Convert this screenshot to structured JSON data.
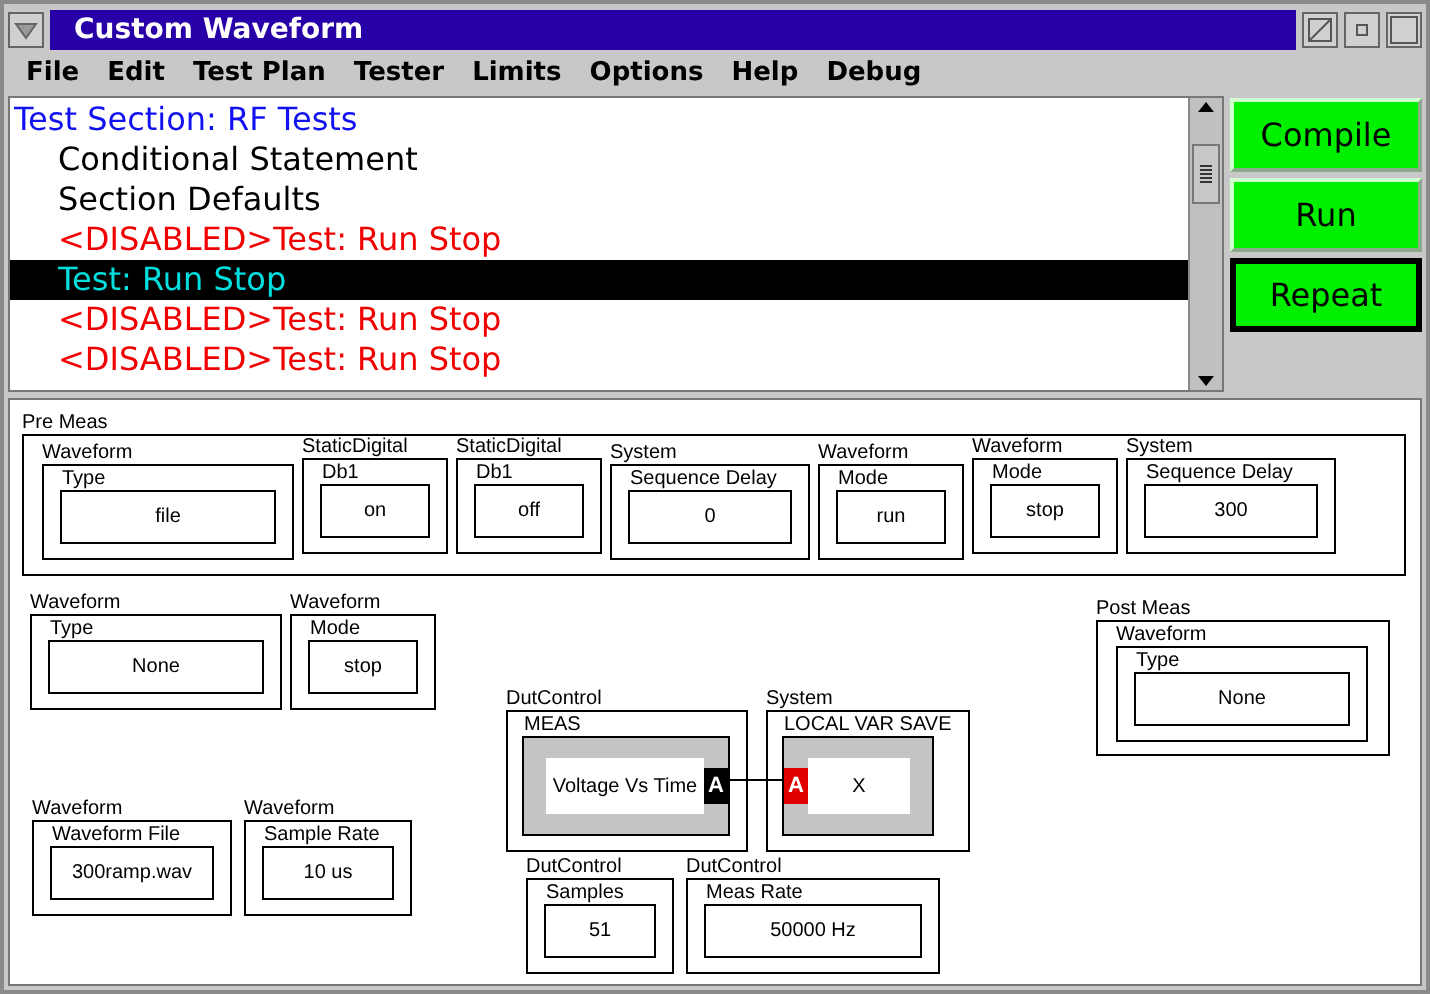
{
  "window": {
    "title": "Custom Waveform"
  },
  "menu": [
    "File",
    "Edit",
    "Test Plan",
    "Tester",
    "Limits",
    "Options",
    "Help",
    "Debug"
  ],
  "test_list": [
    {
      "label": "Test Section: RF Tests",
      "kind": "section",
      "disabled": false,
      "selected": false
    },
    {
      "label": "Conditional Statement",
      "kind": "item",
      "disabled": false,
      "selected": false
    },
    {
      "label": "Section Defaults",
      "kind": "item",
      "disabled": false,
      "selected": false
    },
    {
      "label": "<DISABLED>Test: Run Stop",
      "kind": "item",
      "disabled": true,
      "selected": false
    },
    {
      "label": "Test: Run Stop",
      "kind": "item",
      "disabled": false,
      "selected": true
    },
    {
      "label": "<DISABLED>Test: Run Stop",
      "kind": "item",
      "disabled": true,
      "selected": false
    },
    {
      "label": "<DISABLED>Test: Run Stop",
      "kind": "item",
      "disabled": true,
      "selected": false
    }
  ],
  "actions": [
    {
      "label": "Compile",
      "focused": false
    },
    {
      "label": "Run",
      "focused": false
    },
    {
      "label": "Repeat",
      "focused": true
    }
  ],
  "pre_meas": {
    "title": "Pre Meas",
    "blocks": [
      {
        "category": "Waveform",
        "label": "Type",
        "value": "file"
      },
      {
        "category": "StaticDigital",
        "label": "Db1",
        "value": "on"
      },
      {
        "category": "StaticDigital",
        "label": "Db1",
        "value": "off"
      },
      {
        "category": "System",
        "label": "Sequence Delay",
        "value": "0"
      },
      {
        "category": "Waveform",
        "label": "Mode",
        "value": "run"
      },
      {
        "category": "Waveform",
        "label": "Mode",
        "value": "stop"
      },
      {
        "category": "System",
        "label": "Sequence Delay",
        "value": "300"
      }
    ]
  },
  "blocks": [
    {
      "kind": "param",
      "category": "Waveform",
      "label": "Type",
      "value": "None"
    },
    {
      "kind": "param",
      "category": "Waveform",
      "label": "Mode",
      "value": "stop"
    },
    {
      "kind": "node",
      "category": "DutControl",
      "label": "MEAS",
      "value": "Voltage Vs Time",
      "port": {
        "label": "A",
        "kind": "output"
      }
    },
    {
      "kind": "node",
      "category": "System",
      "label": "LOCAL VAR SAVE",
      "value": "X",
      "port": {
        "label": "A",
        "kind": "input"
      }
    },
    {
      "kind": "param",
      "category": "Waveform",
      "label": "Waveform File",
      "value": "300ramp.wav"
    },
    {
      "kind": "param",
      "category": "Waveform",
      "label": "Sample Rate",
      "value": "10 us"
    },
    {
      "kind": "param",
      "category": "DutControl",
      "label": "Samples",
      "value": "51"
    },
    {
      "kind": "param",
      "category": "DutControl",
      "label": "Meas Rate",
      "value": "50000 Hz"
    }
  ],
  "post_meas": {
    "title": "Post Meas",
    "blocks": [
      {
        "category": "Waveform",
        "label": "Type",
        "value": "None"
      }
    ]
  }
}
